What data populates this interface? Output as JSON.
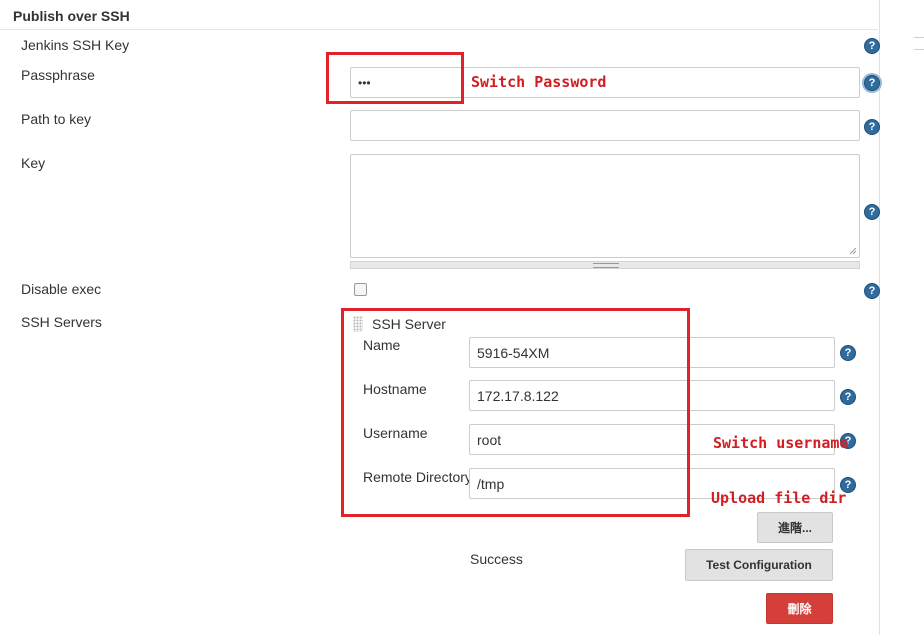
{
  "section": {
    "title": "Publish over SSH"
  },
  "fields": {
    "jenkins_ssh_key_label": "Jenkins SSH Key",
    "passphrase_label": "Passphrase",
    "passphrase_value": "•••",
    "path_to_key_label": "Path to key",
    "key_label": "Key",
    "disable_exec_label": "Disable exec",
    "ssh_servers_label": "SSH Servers"
  },
  "ssh_server": {
    "title": "SSH Server",
    "name_label": "Name",
    "name_value": "5916-54XM",
    "hostname_label": "Hostname",
    "hostname_value": "172.17.8.122",
    "username_label": "Username",
    "username_value": "root",
    "remote_dir_label": "Remote Directory",
    "remote_dir_value": "/tmp",
    "advanced_button": "進階...",
    "status_text": "Success",
    "test_button": "Test Configuration",
    "delete_button": "刪除"
  },
  "annotations": {
    "switch_password": "Switch Password",
    "switch_username": "Switch username",
    "upload_dir": "Upload file dir"
  },
  "help_glyph": "?",
  "colors": {
    "highlight": "#e0222b",
    "help_icon": "#2f6b9c",
    "delete_button": "#d43f3a"
  }
}
